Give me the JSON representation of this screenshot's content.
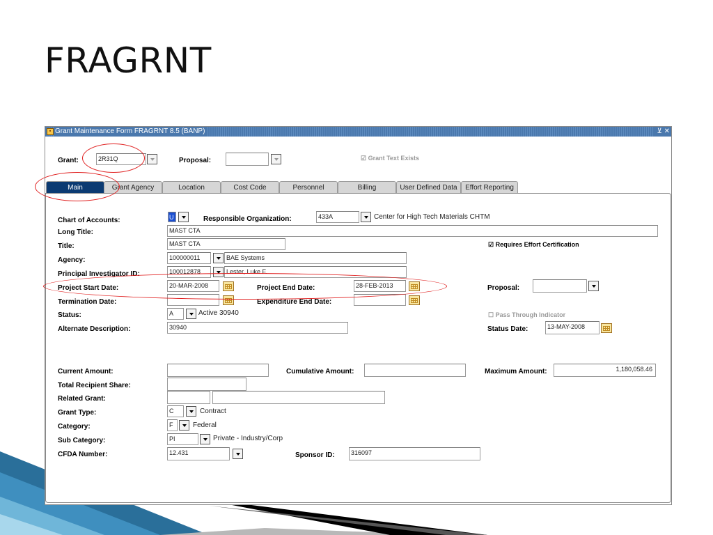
{
  "slide": {
    "title": "FRAGRNT"
  },
  "window": {
    "title": "Grant Maintenance Form  FRAGRNT  8.5  (BANP)",
    "controls": "⊻ ✕"
  },
  "header": {
    "grant_label": "Grant:",
    "grant_value": "2R31Q",
    "proposal_label": "Proposal:",
    "proposal_value": "",
    "grant_text_exists": "Grant Text Exists"
  },
  "tabs": [
    "Main",
    "Grant Agency",
    "Location",
    "Cost Code",
    "Personnel",
    "Billing",
    "User Defined Data",
    "Effort Reporting"
  ],
  "main": {
    "chart_label": "Chart of Accounts:",
    "chart_value": "U",
    "resp_org_label": "Responsible Organization:",
    "resp_org_value": "433A",
    "resp_org_desc": "Center for High Tech Materials CHTM",
    "long_title_label": "Long Title:",
    "long_title_value": "MAST CTA",
    "title_label": "Title:",
    "title_value": "MAST CTA",
    "requires_effort": "Requires Effort Certification",
    "agency_label": "Agency:",
    "agency_value": "100000011",
    "agency_desc": "BAE Systems",
    "pi_label": "Principal Investigator ID:",
    "pi_value": "100012878",
    "pi_desc": "Lester, Luke F.",
    "start_label": "Project Start Date:",
    "start_value": "20-MAR-2008",
    "end_label": "Project End Date:",
    "end_value": "28-FEB-2013",
    "proposal_label": "Proposal:",
    "proposal_value": "",
    "termination_label": "Termination Date:",
    "termination_value": "",
    "exp_end_label": "Expenditure End Date:",
    "exp_end_value": "",
    "status_label": "Status:",
    "status_value": "A",
    "status_desc": "Active 30940",
    "pass_through": "Pass Through Indicator",
    "alt_desc_label": "Alternate Description:",
    "alt_desc_value": "30940",
    "status_date_label": "Status Date:",
    "status_date_value": "13-MAY-2008",
    "current_amount_label": "Current Amount:",
    "current_amount_value": "",
    "cumulative_label": "Cumulative Amount:",
    "cumulative_value": "",
    "maximum_label": "Maximum Amount:",
    "maximum_value": "1,180,058.46",
    "recipient_label": "Total Recipient Share:",
    "recipient_value": "",
    "related_label": "Related Grant:",
    "related_value": "",
    "related_desc": "",
    "grant_type_label": "Grant Type:",
    "grant_type_value": "C",
    "grant_type_desc": "Contract",
    "category_label": "Category:",
    "category_value": "F",
    "category_desc": "Federal",
    "subcat_label": "Sub Category:",
    "subcat_value": "PI",
    "subcat_desc": "Private - Industry/Corp",
    "cfda_label": "CFDA Number:",
    "cfda_value": "12.431",
    "sponsor_label": "Sponsor ID:",
    "sponsor_value": "316097"
  },
  "colors": {
    "active_tab": "#0b3a72",
    "titlebar": "#4a78ad",
    "annotation": "#e02020"
  }
}
